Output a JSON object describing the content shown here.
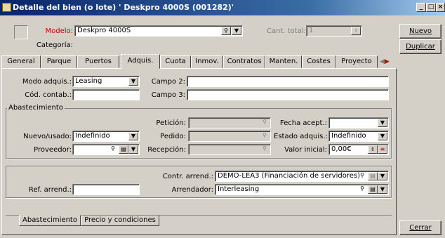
{
  "window": {
    "title": "Detalle del bien (o lote) ' Deskpro 4000S (001282)'",
    "min": "_",
    "max": "□",
    "close": "×"
  },
  "header": {
    "modelo_label": "Modelo:",
    "modelo_value": "Deskpro 4000S",
    "cant_label": "Cant. total:",
    "cant_value": "1",
    "categoria_label": "Categoría:"
  },
  "buttons": {
    "nuevo": "Nuevo",
    "duplicar": "Duplicar",
    "cerrar": "Cerrar"
  },
  "tabs": [
    "General",
    "Parque",
    "Puertos",
    "Adquis.",
    "Cuota",
    "Inmov.",
    "Contratos",
    "Manten.",
    "Costes",
    "Proyecto"
  ],
  "active_tab": "Adquis.",
  "adquis": {
    "modo_label": "Modo adquis.:",
    "modo_value": "Leasing",
    "campo2_label": "Campo 2:",
    "campo2_value": "",
    "cod_label": "Cód. contab.:",
    "cod_value": "",
    "campo3_label": "Campo 3:",
    "campo3_value": ""
  },
  "abastecimiento": {
    "group_label": "Abastecimiento",
    "peticion_label": "Petición:",
    "fecha_label": "Fecha acept.:",
    "fecha_value": "",
    "nuevo_label": "Nuevo/usado:",
    "nuevo_value": "Indefinido",
    "pedido_label": "Pedido:",
    "estado_label": "Estado adquis.:",
    "estado_value": "Indefinido",
    "proveedor_label": "Proveedor:",
    "proveedor_value": "",
    "recepcion_label": "Recepción:",
    "valor_label": "Valor inicial:",
    "valor_value": "0,00€"
  },
  "arrend": {
    "contr_label": "Contr. arrend.:",
    "contr_value": "DEMO-LEA3 (Financiación de servidores)",
    "ref_label": "Ref. arrend.:",
    "ref_value": "",
    "arrendador_label": "Arrendador:",
    "arrendador_value": "Interleasing"
  },
  "bottom_tabs": [
    "Abastecimiento",
    "Precio y condiciones"
  ]
}
